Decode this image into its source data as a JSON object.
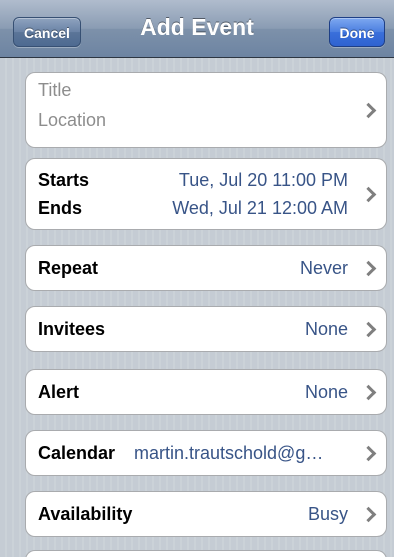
{
  "navbar": {
    "title": "Add Event",
    "cancel_label": "Cancel",
    "done_label": "Done"
  },
  "event": {
    "title_placeholder": "Title",
    "location_placeholder": "Location",
    "starts_label": "Starts",
    "starts_value": "Tue, Jul 20  11:00 PM",
    "ends_label": "Ends",
    "ends_value": "Wed, Jul 21  12:00 AM",
    "repeat_label": "Repeat",
    "repeat_value": "Never",
    "invitees_label": "Invitees",
    "invitees_value": "None",
    "alert_label": "Alert",
    "alert_value": "None",
    "calendar_label": "Calendar",
    "calendar_value": "martin.trautschold@g…",
    "availability_label": "Availability",
    "availability_value": "Busy"
  },
  "icons": {
    "disclosure": "chevron-right-icon"
  },
  "colors": {
    "value_text": "#385487",
    "placeholder_text": "#8d8d8d",
    "navbar": "#7d91aa",
    "done_button": "#3a6fdb"
  }
}
